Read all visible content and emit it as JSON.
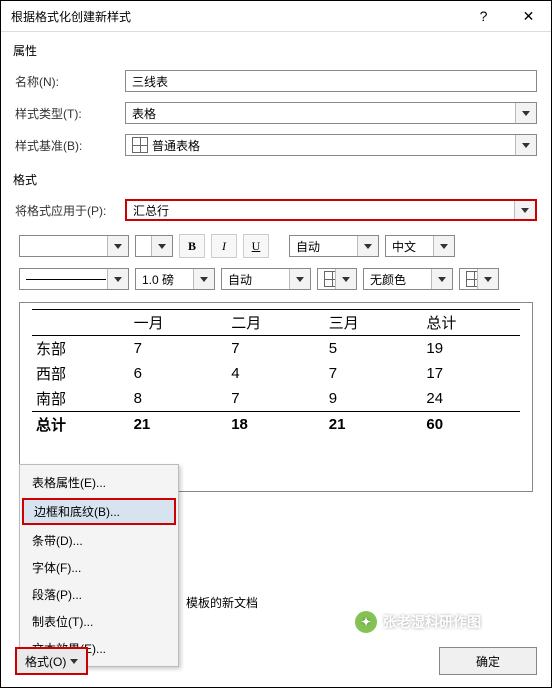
{
  "titlebar": {
    "title": "根据格式化创建新样式",
    "help": "?",
    "close": "✕"
  },
  "section": {
    "props": "属性",
    "format": "格式"
  },
  "labels": {
    "name": "名称(N):",
    "styleType": "样式类型(T):",
    "styleBase": "样式基准(B):",
    "applyTo": "将格式应用于(P):"
  },
  "fields": {
    "name": "三线表",
    "styleType": "表格",
    "styleBase": "普通表格",
    "applyTo": "汇总行"
  },
  "toolbar1": {
    "bold": "B",
    "italic": "I",
    "underline": "U",
    "auto": "自动",
    "lang": "中文"
  },
  "toolbar2": {
    "lineWeight": "1.0 磅",
    "auto": "自动",
    "noColor": "无颜色"
  },
  "table": {
    "headers": [
      "",
      "一月",
      "二月",
      "三月",
      "总计"
    ],
    "rows": [
      {
        "label": "东部",
        "c1": "7",
        "c2": "7",
        "c3": "5",
        "total": "19"
      },
      {
        "label": "西部",
        "c1": "6",
        "c2": "4",
        "c3": "7",
        "total": "17"
      },
      {
        "label": "南部",
        "c1": "8",
        "c2": "7",
        "c3": "9",
        "total": "24"
      }
    ],
    "footer": {
      "label": "总计",
      "c1": "21",
      "c2": "18",
      "c3": "21",
      "total": "60"
    }
  },
  "menu": {
    "tableProps": "表格属性(E)...",
    "borders": "边框和底纹(B)...",
    "stripes": "条带(D)...",
    "font": "字体(F)...",
    "paragraph": "段落(P)...",
    "tabs": "制表位(T)...",
    "textFx": "文本效果(E)..."
  },
  "bottomText": "模板的新文档",
  "formatBtn": "格式(O)",
  "okBtn": "确定",
  "watermark": "张老湿科研作图"
}
